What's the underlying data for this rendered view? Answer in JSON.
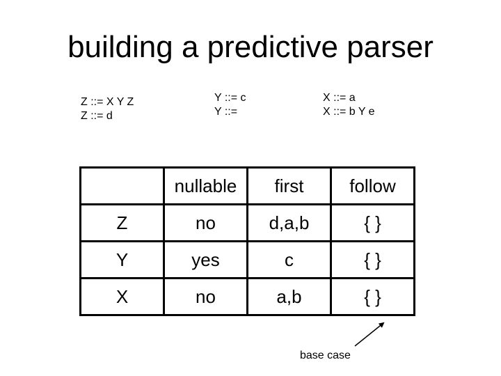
{
  "slide": {
    "title": "building a predictive parser"
  },
  "grammar": {
    "z_rules": [
      "Z ::= X Y Z",
      "Z ::= d"
    ],
    "y_rules": [
      "Y ::= c",
      "Y ::="
    ],
    "x_rules": [
      "X ::= a",
      "X ::= b Y e"
    ]
  },
  "table": {
    "headers": [
      "",
      "nullable",
      "first",
      "follow"
    ],
    "rows": [
      {
        "symbol": "Z",
        "nullable": "no",
        "first": "d,a,b",
        "follow": "{ }"
      },
      {
        "symbol": "Y",
        "nullable": "yes",
        "first": "c",
        "follow": "{ }"
      },
      {
        "symbol": "X",
        "nullable": "no",
        "first": "a,b",
        "follow": "{ }"
      }
    ]
  },
  "annotation": {
    "label": "base case",
    "arrow_icon": "arrow-up-right-icon"
  }
}
